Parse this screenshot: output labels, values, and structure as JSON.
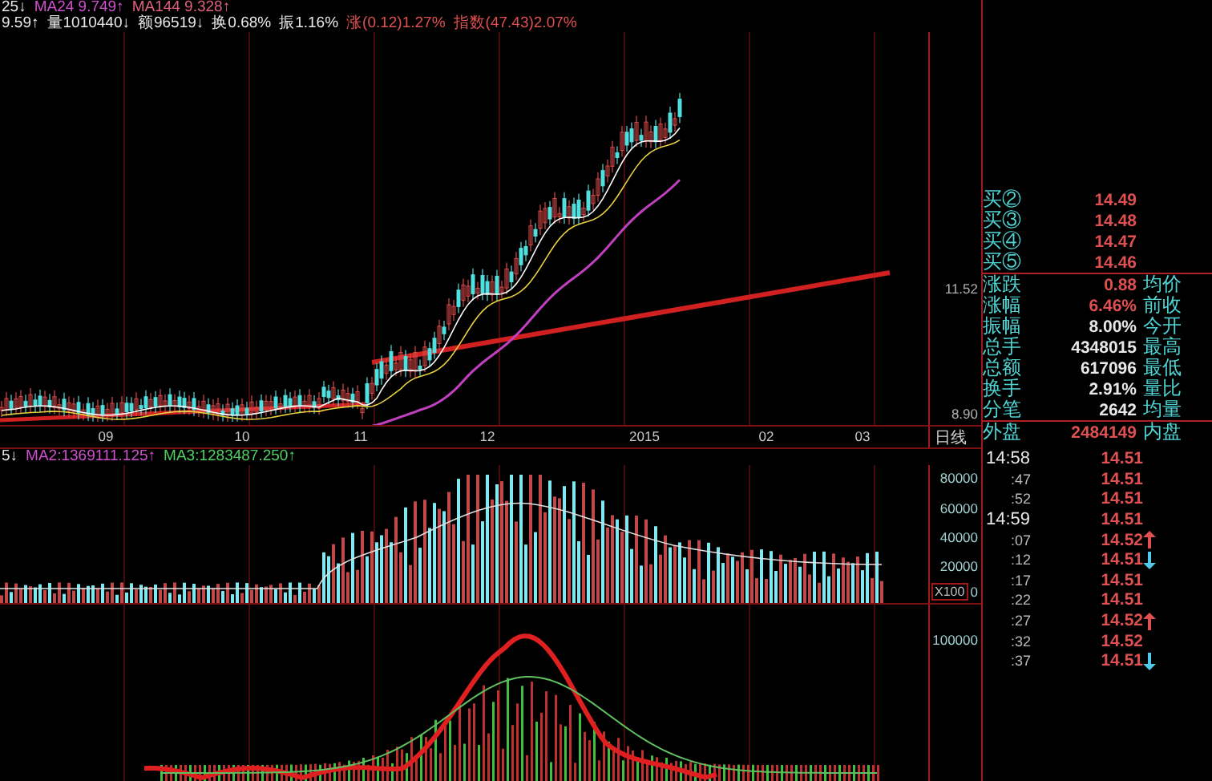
{
  "header": {
    "line_1": [
      {
        "text": "25↓",
        "color": "#e8e8e8"
      },
      {
        "text": "MA24 9.749↑",
        "color": "#d050d0"
      },
      {
        "text": "MA144 9.328↑",
        "color": "#e06080"
      }
    ],
    "line_2": [
      {
        "text": "9.59↑",
        "color": "#e8e8e8"
      },
      {
        "text": "量1010440↓",
        "color": "#e8e8e8"
      },
      {
        "text": "额96519↓",
        "color": "#e8e8e8"
      },
      {
        "text": "换0.68%",
        "color": "#e8e8e8"
      },
      {
        "text": "振1.16%",
        "color": "#e8e8e8"
      },
      {
        "text": "涨(0.12)1.27%",
        "color": "#e05050"
      },
      {
        "text": "指数(47.43)2.07%",
        "color": "#e05050"
      }
    ]
  },
  "price_axis": [
    "11.52",
    "8.90"
  ],
  "x_axis": [
    "09",
    "10",
    "11",
    "12",
    "2015",
    "02",
    "03"
  ],
  "period_label": "日线",
  "volume_header": [
    {
      "text": "5↓",
      "color": "#e8e8e8"
    },
    {
      "text": "MA2:1369111.125↑",
      "color": "#d050d0"
    },
    {
      "text": "MA3:1283487.250↑",
      "color": "#50d060"
    }
  ],
  "volume_axis": [
    "80000",
    "60000",
    "40000",
    "20000"
  ],
  "volume_unit": "X100",
  "volume_zero": "0",
  "indicator_axis": [
    "100000"
  ],
  "order_book": [
    {
      "label": "买②",
      "price": "14.49"
    },
    {
      "label": "买③",
      "price": "14.48"
    },
    {
      "label": "买④",
      "price": "14.47"
    },
    {
      "label": "买⑤",
      "price": "14.46"
    }
  ],
  "stats": [
    {
      "label": "涨跌",
      "value": "0.88",
      "highlighted": true,
      "right_label": "均价"
    },
    {
      "label": "涨幅",
      "value": "6.46%",
      "highlighted": true,
      "right_label": "前收"
    },
    {
      "label": "振幅",
      "value": "8.00%",
      "highlighted": false,
      "right_label": "今开"
    },
    {
      "label": "总手",
      "value": "4348015",
      "highlighted": false,
      "right_label": "最高"
    },
    {
      "label": "总额",
      "value": "617096",
      "highlighted": false,
      "right_label": "最低"
    },
    {
      "label": "换手",
      "value": "2.91%",
      "highlighted": false,
      "right_label": "量比"
    },
    {
      "label": "分笔",
      "value": "2642",
      "highlighted": false,
      "right_label": "均量"
    },
    {
      "label": "外盘",
      "value": "2484149",
      "highlighted": true,
      "right_label": "内盘"
    }
  ],
  "ticks": [
    {
      "time": "14:58",
      "kind": "minute",
      "price": "14.51",
      "up_arrow": false,
      "down_arrow": false
    },
    {
      "time": ":47",
      "kind": "second",
      "price": "14.51",
      "up_arrow": false,
      "down_arrow": false
    },
    {
      "time": ":52",
      "kind": "second",
      "price": "14.51",
      "up_arrow": false,
      "down_arrow": false
    },
    {
      "time": "14:59",
      "kind": "minute",
      "price": "14.51",
      "up_arrow": false,
      "down_arrow": false
    },
    {
      "time": ":07",
      "kind": "second",
      "price": "14.52",
      "up_arrow": true,
      "down_arrow": false
    },
    {
      "time": ":12",
      "kind": "second",
      "price": "14.51",
      "up_arrow": false,
      "down_arrow": true
    },
    {
      "time": ":17",
      "kind": "second",
      "price": "14.51",
      "up_arrow": false,
      "down_arrow": false
    },
    {
      "time": ":22",
      "kind": "second",
      "price": "14.51",
      "up_arrow": false,
      "down_arrow": false
    },
    {
      "time": ":27",
      "kind": "second",
      "price": "14.52",
      "up_arrow": true,
      "down_arrow": false
    },
    {
      "time": ":32",
      "kind": "second",
      "price": "14.52",
      "up_arrow": false,
      "down_arrow": false
    },
    {
      "time": ":37",
      "kind": "second",
      "price": "14.51",
      "up_arrow": false,
      "down_arrow": true
    }
  ]
}
